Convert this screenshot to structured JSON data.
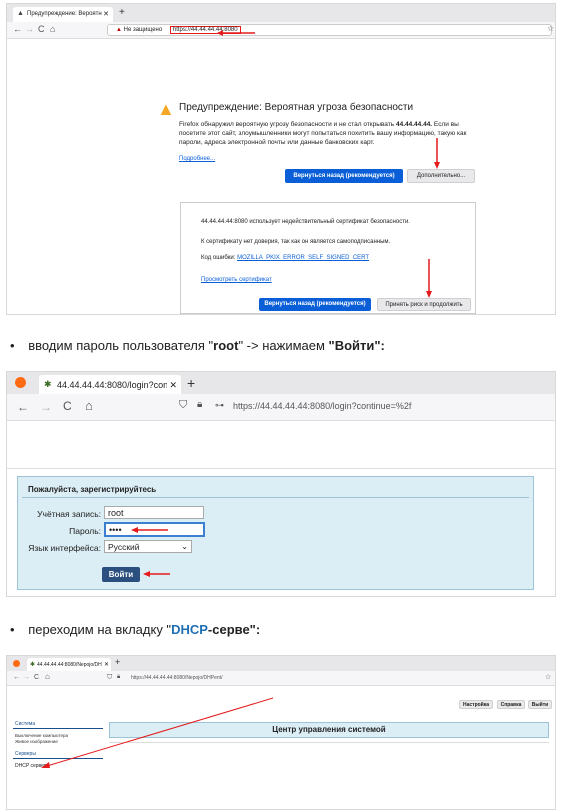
{
  "shot1": {
    "tab_title": "Предупреждение: Вероятн",
    "address_label": "Не защищено",
    "address_url": "https://44.44.44.44:8080",
    "warning_title": "Предупреждение: Вероятная угроза безопасности",
    "warning_text_1": "Firefox обнаружил вероятную угрозу безопасности и не стал открывать ",
    "warning_host": "44.44.44.44.",
    "warning_text_2": " Если вы посетите этот сайт, злоумышленники могут попытаться похитить вашу информацию, такую как пароли, адреса электронной почты или данные банковских карт.",
    "more_link": "Подробнее...",
    "back_button": "Вернуться назад (рекомендуется)",
    "advanced_button": "Дополнительно...",
    "details_line_1": "44.44.44.44:8080 использует недействительный сертификат безопасности.",
    "details_line_2": "К сертификату нет доверия, так как он является самоподписанным.",
    "error_code_label": "Код ошибки:",
    "error_code": "MOZILLA_PKIX_ERROR_SELF_SIGNED_CERT",
    "view_cert_link": "Просмотреть сертификат",
    "back_button_2": "Вернуться назад (рекомендуется)",
    "accept_button": "Принять риск и продолжить"
  },
  "step1": {
    "prefix": "вводим пароль пользователя \"",
    "user": "root",
    "middle": "\" -> нажимаем ",
    "button": "\"Войти\":"
  },
  "shot2": {
    "tab_title": "44.44.44.44:8080/login?contin",
    "address_url": "https://44.44.44.44:8080/login?continue=%2f",
    "form_title": "Пожалуйста, зарегистрируйтесь",
    "account_label": "Учётная запись:",
    "account_value": "root",
    "password_label": "Пароль:",
    "password_value": "••••",
    "lang_label": "Язык интерфейса:",
    "lang_value": "Русский",
    "login_button": "Войти"
  },
  "step2": {
    "prefix": "переходим на вкладку \"",
    "dhcp": "DHCP",
    "suffix": "-серве\":"
  },
  "shot3": {
    "tab_title": "44.44.44.44:8080/Nepojo/DH",
    "address_url": "https://44.44.44.44:8080/Nepojo/DHPent/",
    "btn_settings": "Настройка",
    "btn_help": "Справка",
    "btn_exit": "Выйти",
    "header_title": "Центр управления системой",
    "side_system": "Система",
    "side_item_1": "Выключение компьютера",
    "side_item_2": "Живое изображение",
    "side_servers": "Серверы",
    "side_dhcp": "DHCP сервер"
  }
}
